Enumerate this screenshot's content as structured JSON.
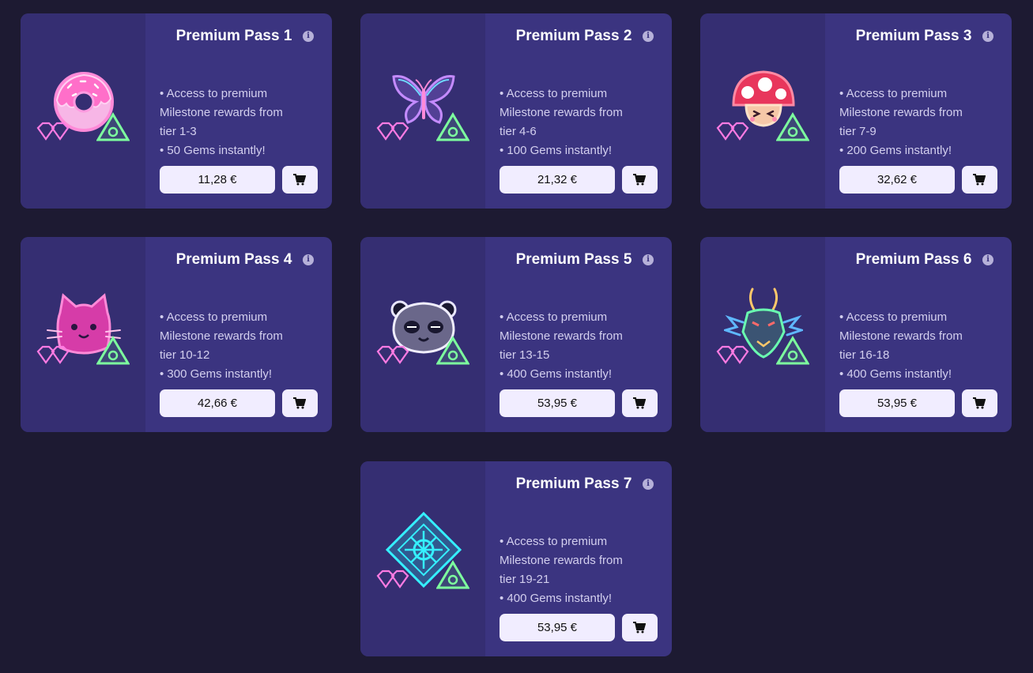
{
  "cards": [
    {
      "title": "Premium Pass 1",
      "art_icon": "donut-icon",
      "line1": "• Access to premium",
      "line2": "Milestone rewards from",
      "line3": "tier 1-3",
      "line4": "• 50 Gems instantly!",
      "price": "11,28 €"
    },
    {
      "title": "Premium Pass 2",
      "art_icon": "butterfly-icon",
      "line1": "• Access to premium",
      "line2": "Milestone rewards from",
      "line3": "tier 4-6",
      "line4": "• 100 Gems instantly!",
      "price": "21,32 €"
    },
    {
      "title": "Premium Pass 3",
      "art_icon": "mushroom-icon",
      "line1": "• Access to premium",
      "line2": "Milestone rewards from",
      "line3": "tier 7-9",
      "line4": "• 200 Gems instantly!",
      "price": "32,62 €"
    },
    {
      "title": "Premium Pass 4",
      "art_icon": "cat-icon",
      "line1": "• Access to premium",
      "line2": "Milestone rewards from",
      "line3": "tier 10-12",
      "line4": "• 300 Gems instantly!",
      "price": "42,66 €"
    },
    {
      "title": "Premium Pass 5",
      "art_icon": "panda-icon",
      "line1": "• Access to premium",
      "line2": "Milestone rewards from",
      "line3": "tier 13-15",
      "line4": "• 400 Gems instantly!",
      "price": "53,95 €"
    },
    {
      "title": "Premium Pass 6",
      "art_icon": "dragon-icon",
      "line1": "• Access to premium",
      "line2": "Milestone rewards from",
      "line3": "tier 16-18",
      "line4": "• 400 Gems instantly!",
      "price": "53,95 €"
    },
    {
      "title": "Premium Pass 7",
      "art_icon": "rune-diamond-icon",
      "line1": "• Access to premium",
      "line2": "Milestone rewards from",
      "line3": "tier 19-21",
      "line4": "• 400 Gems instantly!",
      "price": "53,95 €"
    }
  ],
  "info_icon": "info-icon",
  "cart_icon": "cart-icon",
  "colors": {
    "page_bg": "#1d1a32",
    "card_bg": "#3b3480",
    "art_bg": "#352e72",
    "button_bg": "#f1edff",
    "gem_pink": "#ff7be3",
    "triangle_green": "#7dff9e"
  }
}
